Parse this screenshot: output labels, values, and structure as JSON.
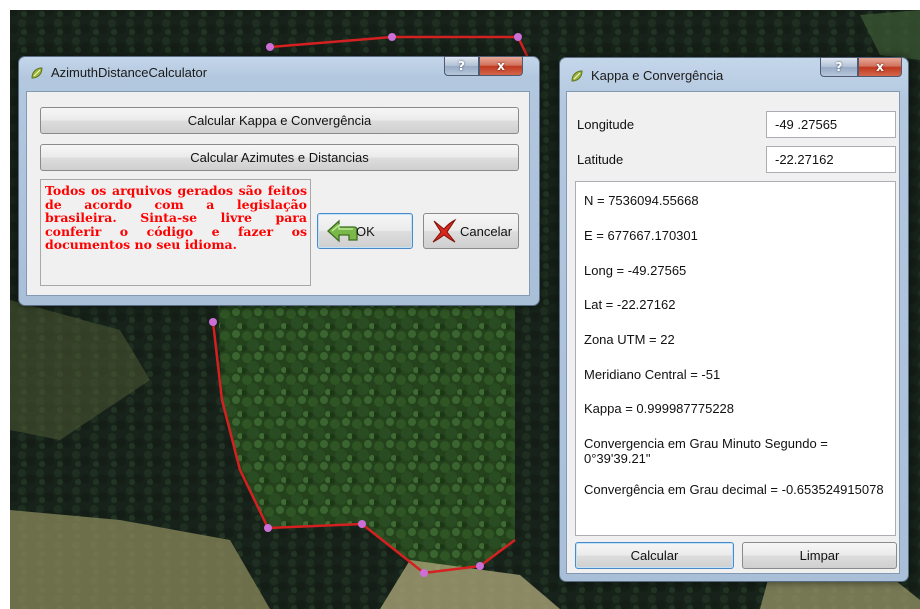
{
  "azimuth_dialog": {
    "title": "AzimuthDistanceCalculator",
    "help_glyph": "?",
    "close_glyph": "x",
    "btn_kappa": "Calcular Kappa e Convergência",
    "btn_azimutes": "Calcular Azimutes e Distancias",
    "notice": "Todos os arquivos gerados são feitos de acordo com a legislação brasileira. Sinta-se livre para conferir o código e fazer os documentos no seu idioma.",
    "ok_label": "OK",
    "cancel_label": "Cancelar"
  },
  "kappa_dialog": {
    "title": "Kappa e Convergência",
    "help_glyph": "?",
    "close_glyph": "x",
    "longitude_label": "Longitude",
    "longitude_value": "-49 .27565",
    "latitude_label": "Latitude",
    "latitude_value": "-22.27162",
    "results": [
      "N = 7536094.55668",
      "E = 677667.170301",
      "Long = -49.27565",
      "Lat = -22.27162",
      "Zona UTM = 22",
      "Meridiano Central = -51",
      "Kappa = 0.999987775228",
      "Convergencia em Grau Minuto Segundo = 0°39'39.21\"",
      "Convergência em Grau decimal = -0.653524915078"
    ],
    "calcular_label": "Calcular",
    "limpar_label": "Limpar"
  },
  "colors": {
    "polygon_line": "#d42020",
    "vertex": "#cc70d8",
    "notice_text": "#ff0000"
  }
}
